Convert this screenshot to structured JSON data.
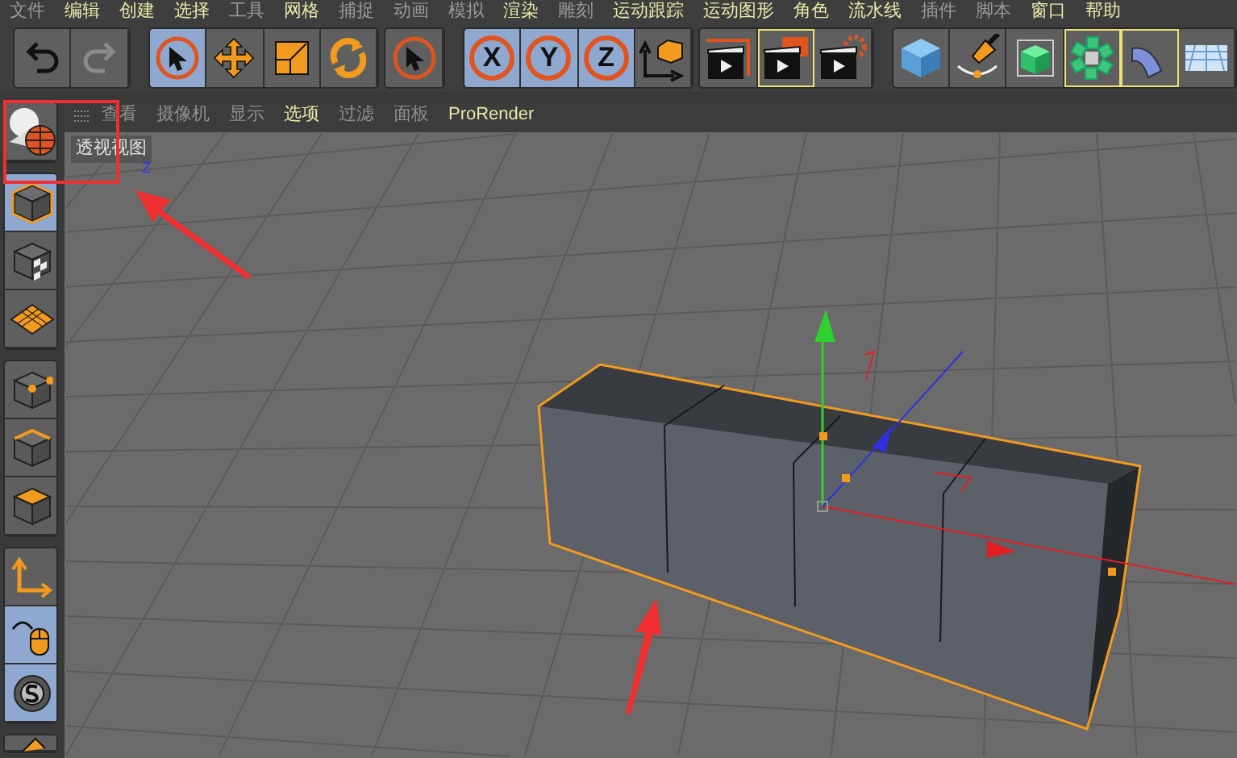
{
  "menu_bar": [
    {
      "label": "文件",
      "highlighted": false
    },
    {
      "label": "编辑",
      "highlighted": true
    },
    {
      "label": "创建",
      "highlighted": true
    },
    {
      "label": "选择",
      "highlighted": true
    },
    {
      "label": "工具",
      "highlighted": false
    },
    {
      "label": "网格",
      "highlighted": true
    },
    {
      "label": "捕捉",
      "highlighted": false
    },
    {
      "label": "动画",
      "highlighted": false
    },
    {
      "label": "模拟",
      "highlighted": false
    },
    {
      "label": "渲染",
      "highlighted": true
    },
    {
      "label": "雕刻",
      "highlighted": false
    },
    {
      "label": "运动跟踪",
      "highlighted": true
    },
    {
      "label": "运动图形",
      "highlighted": true
    },
    {
      "label": "角色",
      "highlighted": true
    },
    {
      "label": "流水线",
      "highlighted": true
    },
    {
      "label": "插件",
      "highlighted": false
    },
    {
      "label": "脚本",
      "highlighted": false
    },
    {
      "label": "窗口",
      "highlighted": true
    },
    {
      "label": "帮助",
      "highlighted": true
    }
  ],
  "toolbar_groups": [
    [
      {
        "kind": "undo",
        "selected": false,
        "framed": false,
        "disabled": false
      },
      {
        "kind": "redo",
        "selected": false,
        "framed": false,
        "disabled": true
      }
    ],
    [
      {
        "kind": "live",
        "selected": true,
        "framed": false
      },
      {
        "kind": "move",
        "selected": false,
        "framed": false
      },
      {
        "kind": "scale",
        "selected": false,
        "framed": false
      },
      {
        "kind": "rotate",
        "selected": false,
        "framed": false
      }
    ],
    [
      {
        "kind": "select",
        "selected": false,
        "framed": false
      }
    ],
    [
      {
        "kind": "letter",
        "label": "X",
        "selected": true,
        "framed": false
      },
      {
        "kind": "letter",
        "label": "Y",
        "selected": true,
        "framed": false
      },
      {
        "kind": "letter",
        "label": "Z",
        "selected": true,
        "framed": false
      },
      {
        "kind": "coord",
        "selected": false,
        "framed": false
      }
    ],
    [
      {
        "kind": "renderview",
        "selected": false,
        "framed": false
      },
      {
        "kind": "renderpic",
        "selected": false,
        "framed": true
      },
      {
        "kind": "rendersettings",
        "selected": false,
        "framed": false
      }
    ],
    [
      {
        "kind": "cube",
        "selected": false,
        "framed": false
      },
      {
        "kind": "pen",
        "selected": false,
        "framed": false
      },
      {
        "kind": "generator",
        "selected": false,
        "framed": false
      },
      {
        "kind": "cloner",
        "selected": false,
        "framed": true
      },
      {
        "kind": "deformer",
        "selected": false,
        "framed": true
      },
      {
        "kind": "floor",
        "selected": false,
        "framed": false
      }
    ]
  ],
  "viewport_menu": [
    {
      "label": "查看",
      "highlighted": false
    },
    {
      "label": "摄像机",
      "highlighted": false
    },
    {
      "label": "显示",
      "highlighted": false
    },
    {
      "label": "选项",
      "highlighted": true
    },
    {
      "label": "过滤",
      "highlighted": false
    },
    {
      "label": "面板",
      "highlighted": false
    },
    {
      "label": "ProRender",
      "highlighted": true
    }
  ],
  "viewport": {
    "title": "透视视图",
    "axis_label": "Z"
  },
  "left_toolbar_groups": [
    [
      {
        "kind": "view",
        "selected": false
      }
    ],
    [
      {
        "kind": "model",
        "selected": true
      },
      {
        "kind": "texture",
        "selected": false
      },
      {
        "kind": "workplane",
        "selected": false
      }
    ],
    [
      {
        "kind": "points",
        "selected": false
      },
      {
        "kind": "edges",
        "selected": false
      },
      {
        "kind": "polygons",
        "selected": false
      }
    ],
    [
      {
        "kind": "axis",
        "selected": false
      },
      {
        "kind": "tweak",
        "selected": true
      },
      {
        "kind": "snap",
        "selected": true
      }
    ],
    [
      {
        "kind": "more",
        "selected": false
      }
    ]
  ]
}
